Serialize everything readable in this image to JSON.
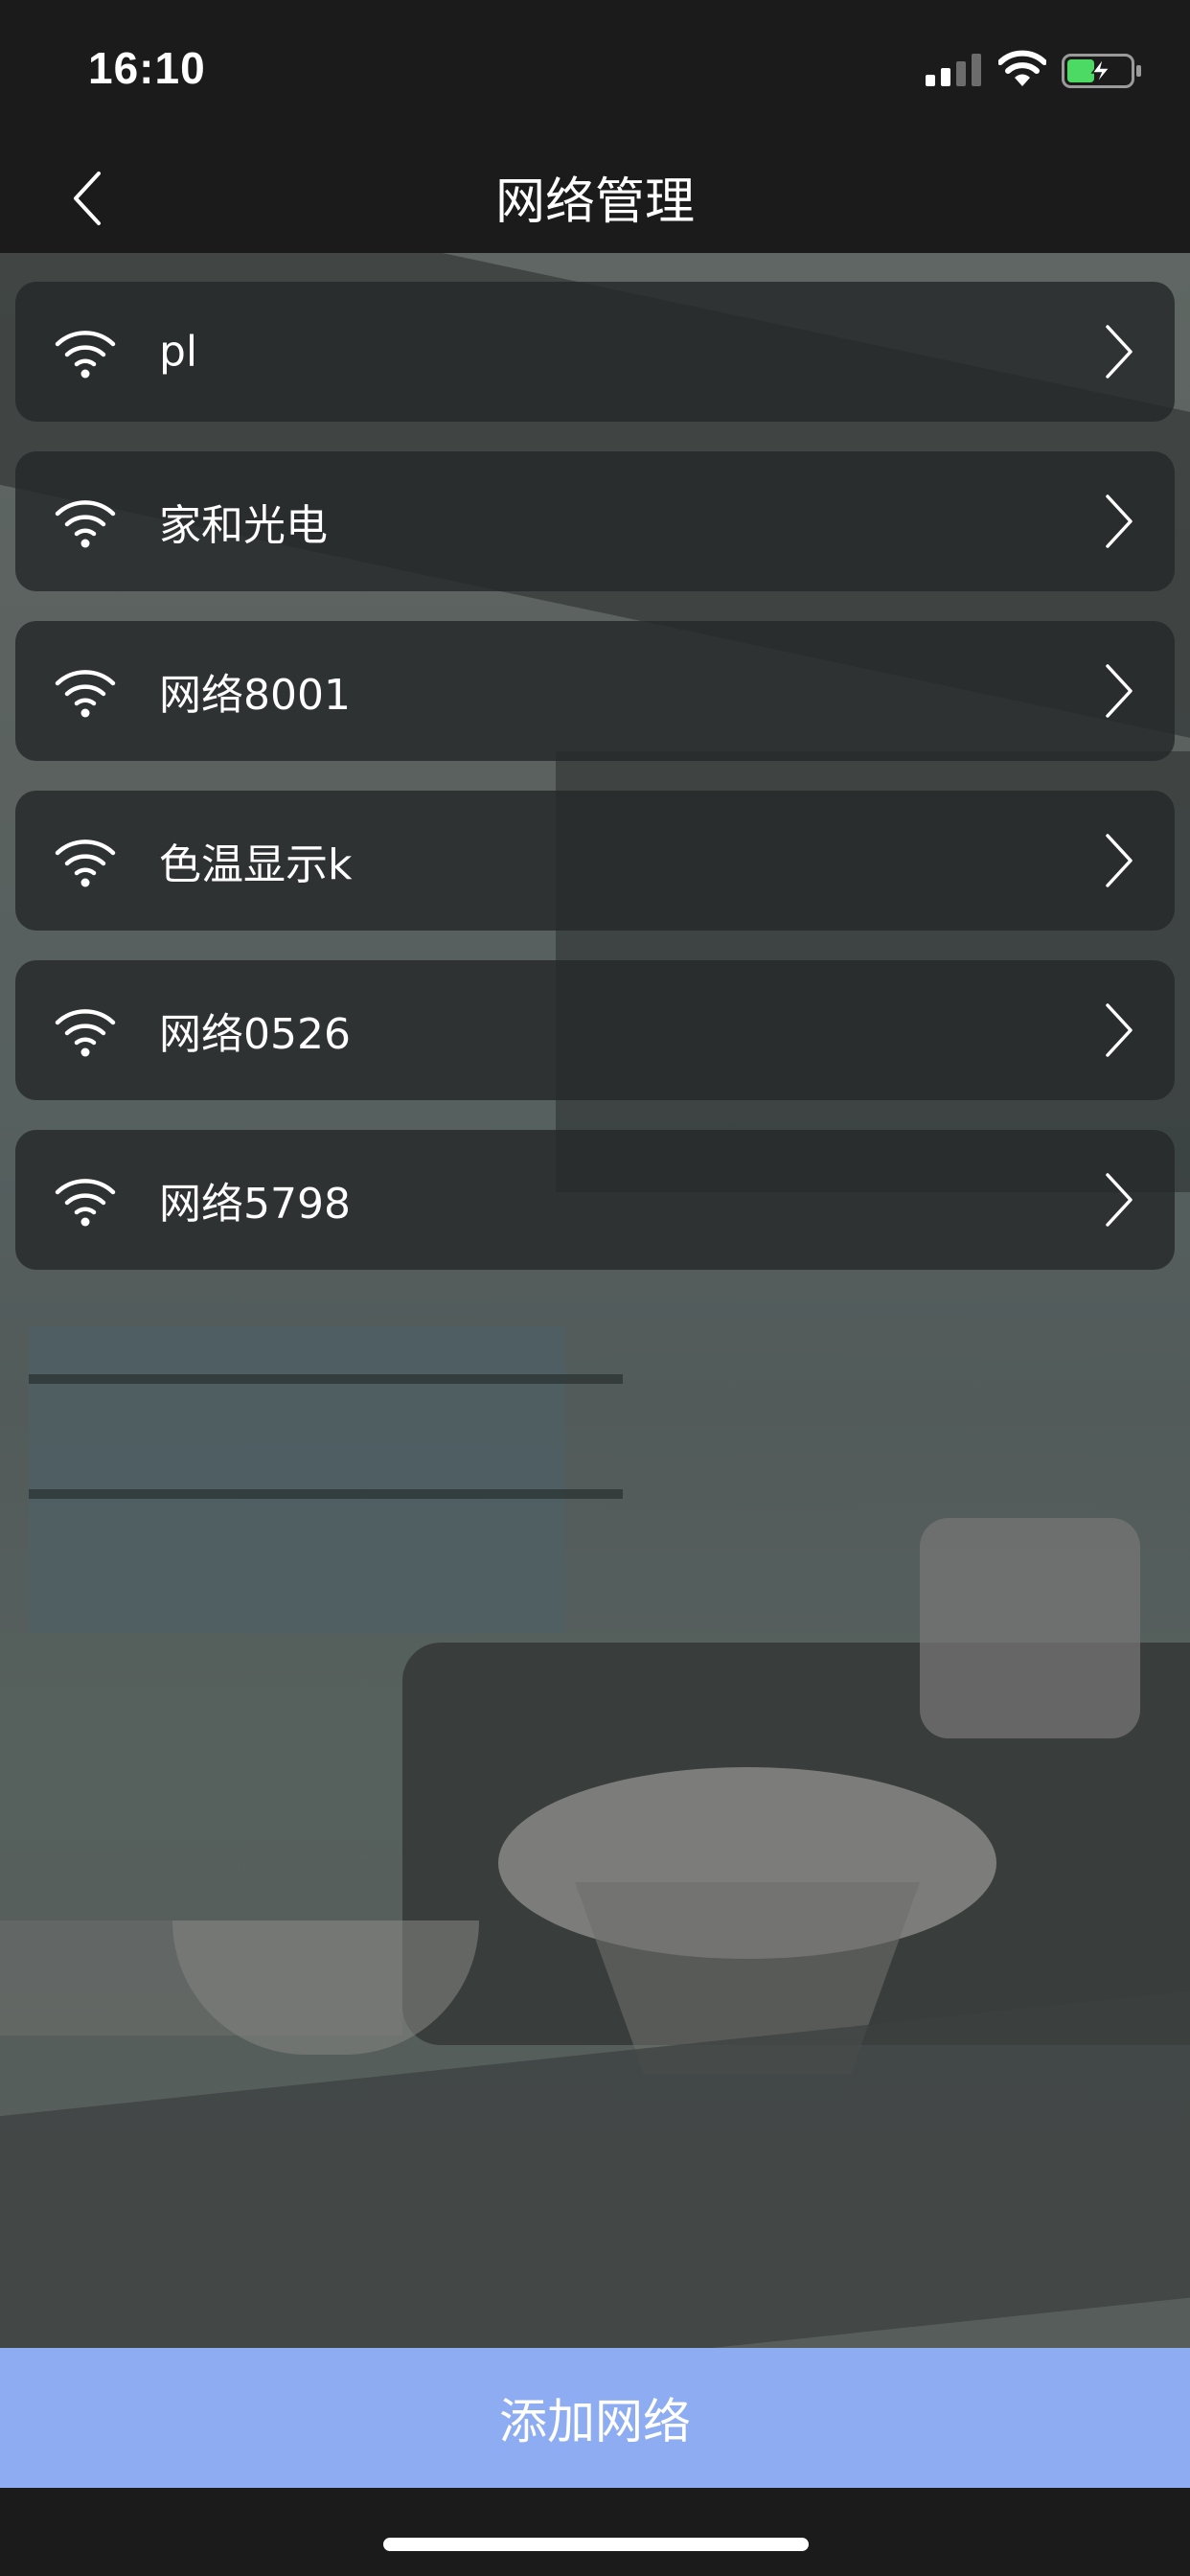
{
  "status_bar": {
    "time": "16:10",
    "icons": [
      "signal-icon",
      "wifi-icon",
      "battery-charging-icon"
    ]
  },
  "nav": {
    "title": "网络管理",
    "back_icon": "chevron-left-icon"
  },
  "networks": [
    {
      "name": "pl",
      "icon": "wifi-icon"
    },
    {
      "name": "家和光电",
      "icon": "wifi-icon"
    },
    {
      "name": "网络8001",
      "icon": "wifi-icon"
    },
    {
      "name": "色温显示k",
      "icon": "wifi-icon"
    },
    {
      "name": "网络0526",
      "icon": "wifi-icon"
    },
    {
      "name": "网络5798",
      "icon": "wifi-icon"
    }
  ],
  "add_button": {
    "label": "添加网络"
  },
  "colors": {
    "bar_background": "#1b1b1c",
    "card_background": "rgba(38,40,42,0.82)",
    "accent_button": "#8dacf2",
    "battery_green": "#4cd964"
  }
}
